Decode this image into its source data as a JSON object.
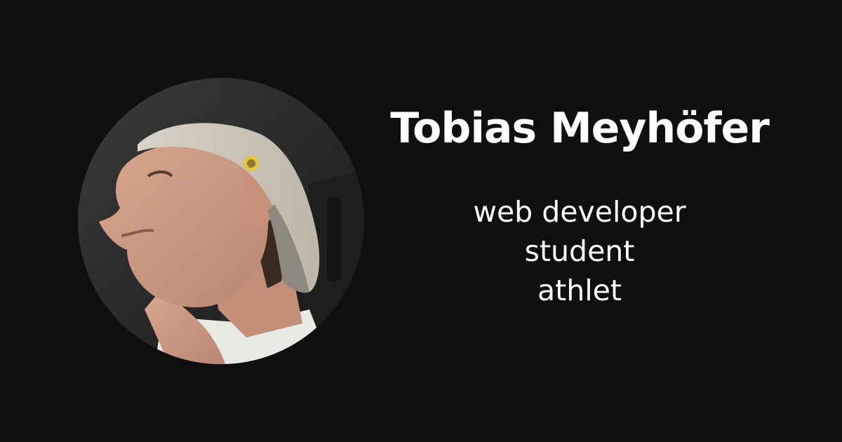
{
  "card": {
    "name": "Tobias Meyhöfer",
    "roles": [
      "web developer",
      "student",
      "athlet"
    ],
    "background_color": "#0f0f0f",
    "text_color": "#ffffff"
  },
  "avatar": {
    "icon": "profile-photo"
  }
}
